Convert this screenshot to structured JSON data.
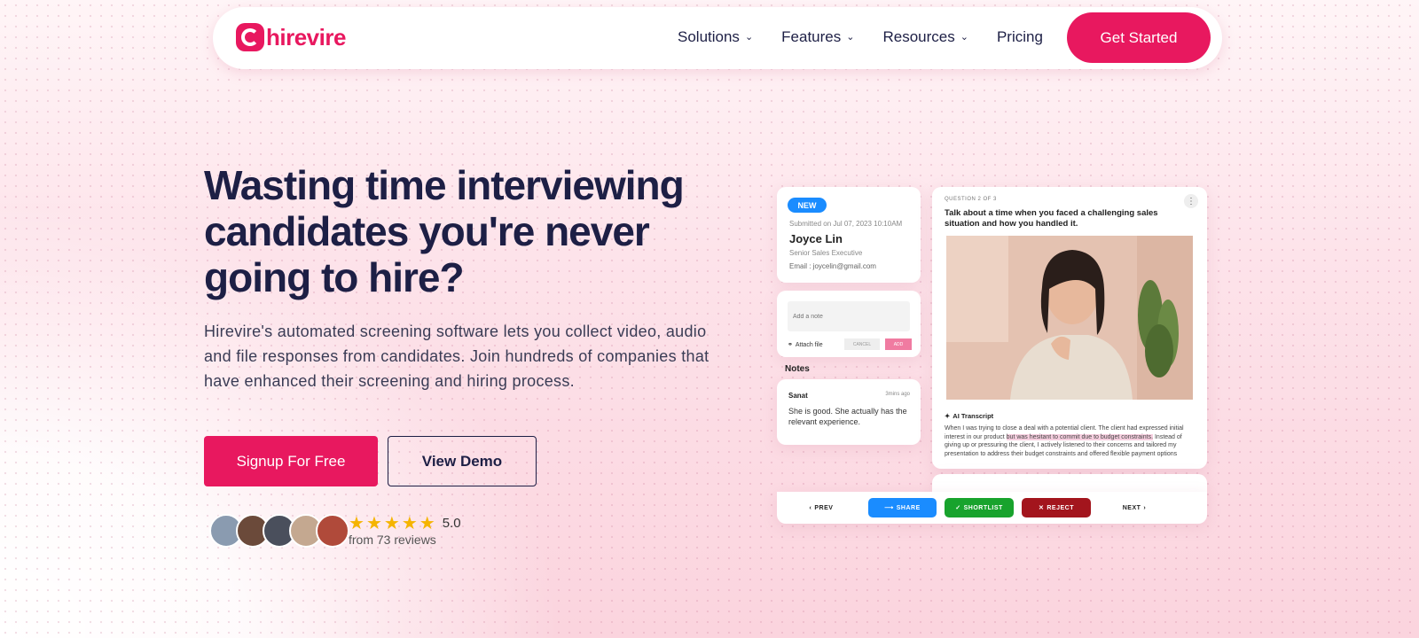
{
  "brand": {
    "name": "hirevire",
    "color": "#e8185f"
  },
  "nav": {
    "items": [
      {
        "label": "Solutions",
        "has_menu": true
      },
      {
        "label": "Features",
        "has_menu": true
      },
      {
        "label": "Resources",
        "has_menu": true
      },
      {
        "label": "Pricing",
        "has_menu": false
      }
    ],
    "cta": "Get Started"
  },
  "hero": {
    "title": "Wasting time interviewing candidates you're never going to hire?",
    "description": "Hirevire's automated screening software lets you collect video, audio and file responses from candidates. Join hundreds of companies that have enhanced their screening and hiring process.",
    "primary_button": "Signup For Free",
    "secondary_button": "View Demo",
    "rating": "5.0",
    "stars": 5,
    "reviews": "from 73 reviews"
  },
  "mockup": {
    "candidate": {
      "badge": "NEW",
      "submitted": "Submitted on Jul 07, 2023 10:10AM",
      "name": "Joyce Lin",
      "role": "Senior Sales Executive",
      "email": "Email    : joycelin@gmail.com"
    },
    "note_box": {
      "placeholder": "Add a note",
      "attach": "Attach file",
      "cancel": "CANCEL",
      "add": "ADD"
    },
    "notes_heading": "Notes",
    "note": {
      "author": "Sanat",
      "time": "3mins ago",
      "text": "She is good. She actually has the relevant experience."
    },
    "question": {
      "number": "QUESTION 2 OF 3",
      "text": "Talk about a time when you faced a challenging sales situation and how you handled it.",
      "more": "⋮"
    },
    "transcript": {
      "heading": "AI Transcript",
      "before": "When I was trying to close a deal with a potential client. The client had expressed initial interest in our product ",
      "highlight": "but was hesitant to commit due to budget constraints.",
      "after": " Instead of giving up or pressuring the client, I actively listened to their concerns and tailored my presentation to address their budget constraints and offered flexible payment options"
    },
    "actions": {
      "prev": "PREV",
      "share": "SHARE",
      "shortlist": "SHORTLIST",
      "reject": "REJECT",
      "next": "NEXT"
    }
  }
}
